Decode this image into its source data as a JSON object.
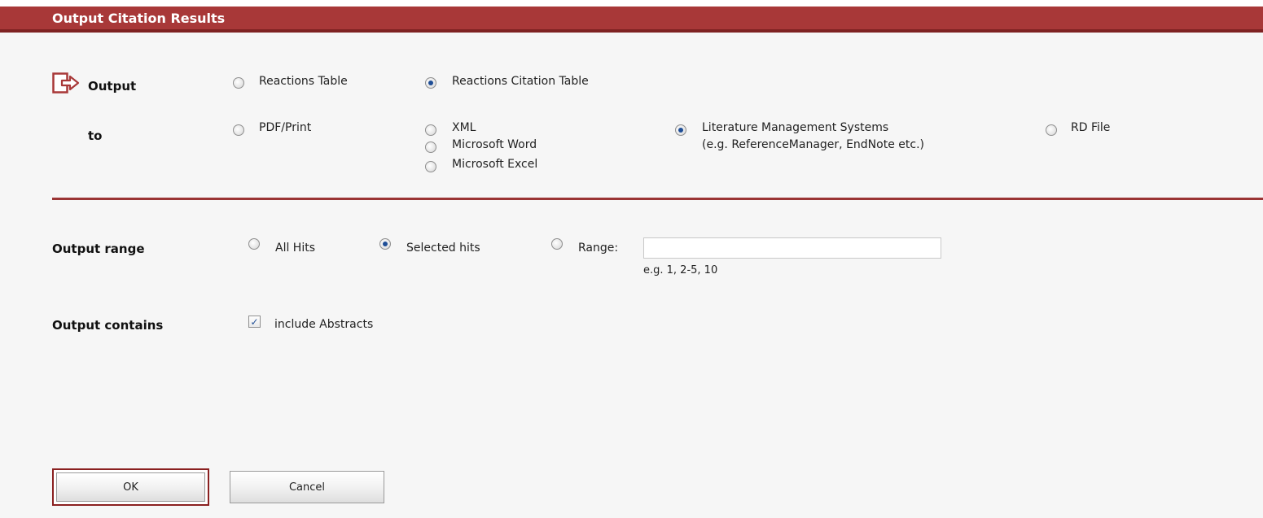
{
  "window": {
    "title": "Output Citation Results"
  },
  "output": {
    "label": "Output",
    "options": [
      {
        "label": "Reactions Table",
        "checked": false
      },
      {
        "label": "Reactions Citation Table",
        "checked": true
      }
    ]
  },
  "to": {
    "label": "to",
    "options": [
      {
        "label": "PDF/Print",
        "checked": false
      },
      {
        "label": "XML",
        "checked": false
      },
      {
        "label": "Microsoft Word",
        "checked": false
      },
      {
        "label": "Microsoft Excel",
        "checked": false
      },
      {
        "label": "Literature Management Systems",
        "sublabel": "(e.g. ReferenceManager, EndNote etc.)",
        "checked": true
      },
      {
        "label": "RD File",
        "checked": false
      }
    ]
  },
  "range": {
    "label": "Output range",
    "options": [
      {
        "label": "All Hits",
        "checked": false
      },
      {
        "label": "Selected hits",
        "checked": true
      },
      {
        "label": "Range:",
        "checked": false
      }
    ],
    "input_value": "",
    "hint": "e.g. 1, 2-5, 10"
  },
  "contains": {
    "label": "Output contains",
    "checkbox_label": "include Abstracts",
    "checked": true
  },
  "buttons": {
    "ok": "OK",
    "cancel": "Cancel"
  },
  "icons": {
    "output_arrow": "arrow-right-icon",
    "check": "✓"
  },
  "colors": {
    "accent": "#a83838",
    "radio_dot": "#1f4e96"
  }
}
